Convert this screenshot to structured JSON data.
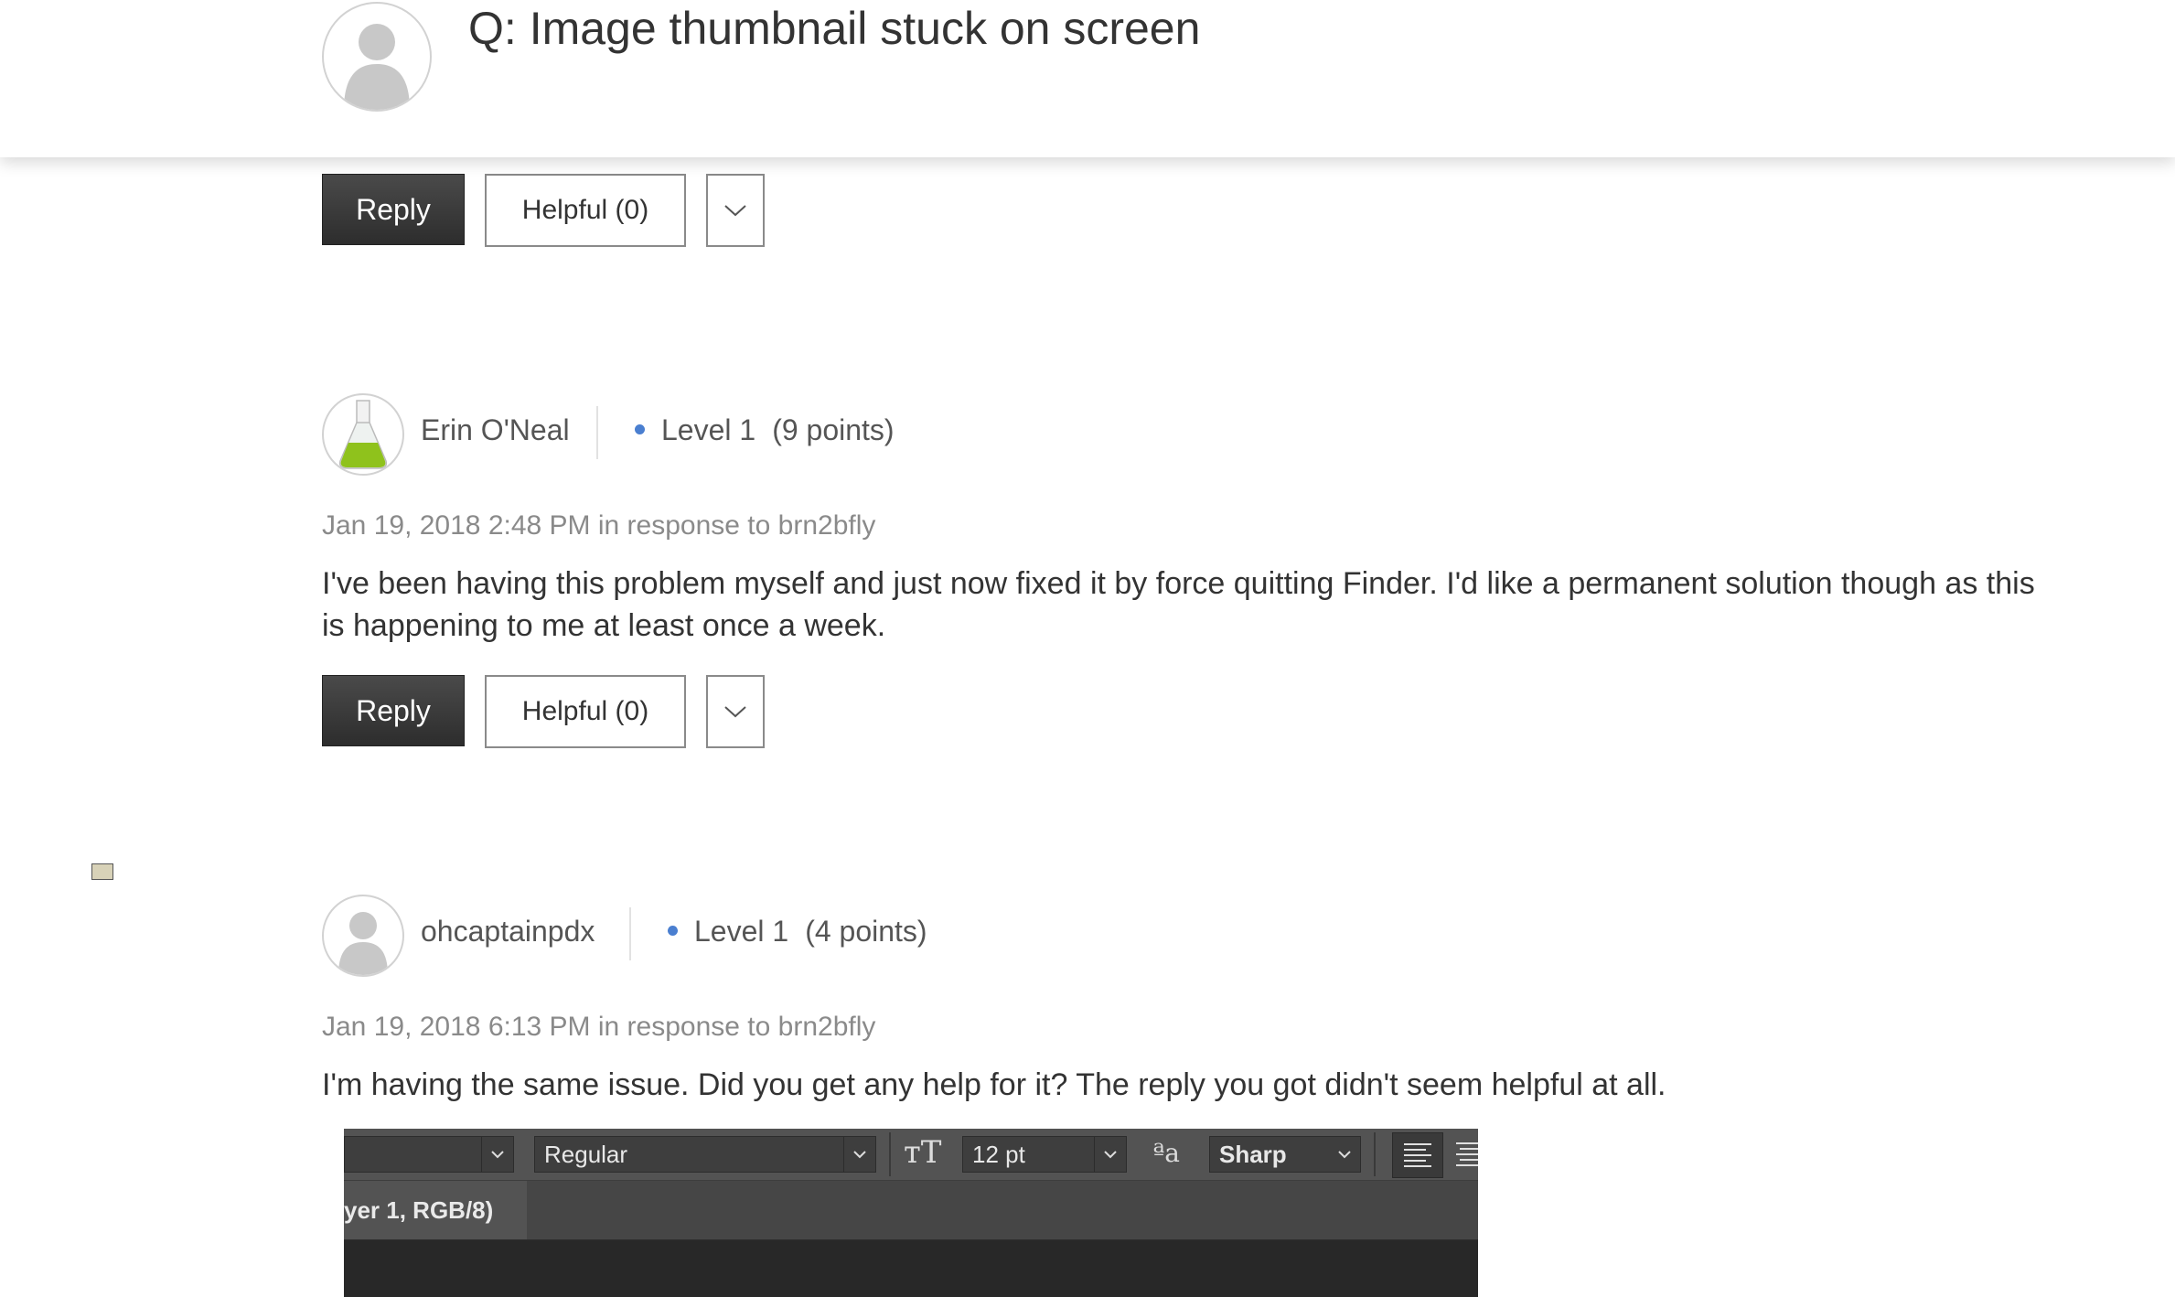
{
  "question": {
    "prefix": "Q:",
    "title": "Image thumbnail stuck on screen"
  },
  "actions": {
    "reply_label": "Reply",
    "helpful_label": "Helpful (0)"
  },
  "posts": [
    {
      "author": "Erin O'Neal",
      "level": "Level 1",
      "points": "(9 points)",
      "meta": "Jan 19, 2018 2:48 PM in response to brn2bfly",
      "body": "I've been having this problem myself and just now fixed it by force quitting Finder. I'd like a permanent solution though as this is happening to me at least once a week.",
      "avatar_icon": "flask-icon"
    },
    {
      "author": "ohcaptainpdx",
      "level": "Level 1",
      "points": "(4 points)",
      "meta": "Jan 19, 2018 6:13 PM in response to brn2bfly",
      "body": "I'm having the same issue. Did you get any help for it? The reply you got didn't seem helpful at all.",
      "avatar_icon": "default-user-icon"
    }
  ],
  "screenshot": {
    "font_style": "Regular",
    "font_size": "12 pt",
    "antialias": "Sharp",
    "tab_label": "yer 1, RGB/8)"
  },
  "colors": {
    "level_dot": "#4a7fd0",
    "reply_button": "#333333"
  }
}
